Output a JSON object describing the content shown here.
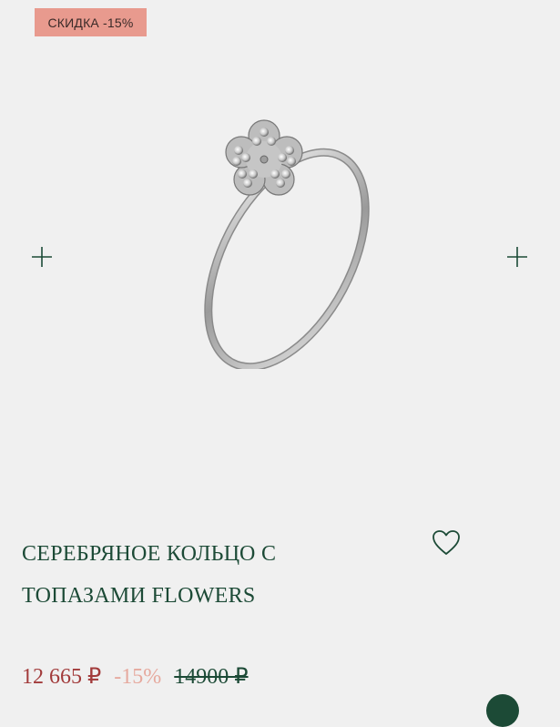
{
  "badge": {
    "label": "СКИДКА -15%",
    "color": "#e89a8e"
  },
  "gallery": {
    "prev_icon": "plus-icon",
    "next_icon": "plus-icon",
    "image": "silver-ring-with-flower-topaz"
  },
  "product": {
    "title_line1": "СЕРЕБРЯНОЕ КОЛЬЦО С",
    "title_line2": "ТОПАЗАМИ FLOWERS",
    "wishlist_icon": "heart-outline-icon"
  },
  "price": {
    "current": "12 665 ₽",
    "discount": "-15%",
    "old": "14900 ₽"
  },
  "colors": {
    "accent_green": "#1c4a36",
    "price_red": "#a23b3b",
    "badge_pink": "#e89a8e",
    "background": "#f0f0f0"
  }
}
